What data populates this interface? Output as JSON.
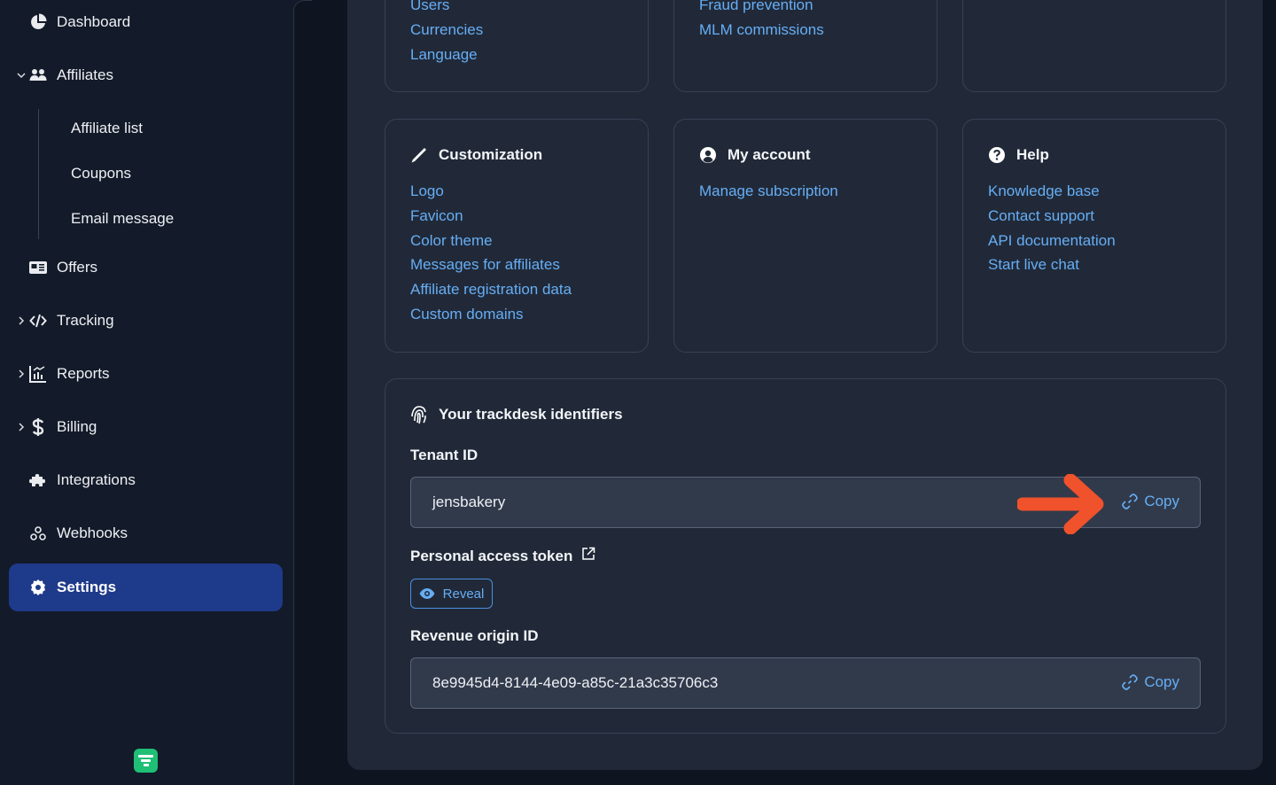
{
  "sidebar": {
    "items": [
      {
        "label": "Dashboard",
        "icon": "pie-chart-icon"
      },
      {
        "label": "Affiliates",
        "icon": "users-icon",
        "expanded": true
      },
      {
        "label": "Offers",
        "icon": "id-card-icon"
      },
      {
        "label": "Tracking",
        "icon": "code-icon",
        "expandable": true
      },
      {
        "label": "Reports",
        "icon": "chart-icon",
        "expandable": true
      },
      {
        "label": "Billing",
        "icon": "dollar-icon",
        "expandable": true
      },
      {
        "label": "Integrations",
        "icon": "puzzle-icon"
      },
      {
        "label": "Webhooks",
        "icon": "webhook-icon"
      },
      {
        "label": "Settings",
        "icon": "gear-icon",
        "active": true
      }
    ],
    "affiliates_sub": [
      "Affiliate list",
      "Coupons",
      "Email message"
    ]
  },
  "cards": {
    "general_partial": {
      "links": [
        "Users",
        "Currencies",
        "Language"
      ]
    },
    "program_partial": {
      "links": [
        "Fraud prevention",
        "MLM commissions"
      ]
    },
    "customization": {
      "title": "Customization",
      "links": [
        "Logo",
        "Favicon",
        "Color theme",
        "Messages for affiliates",
        "Affiliate registration data",
        "Custom domains"
      ]
    },
    "my_account": {
      "title": "My account",
      "links": [
        "Manage subscription"
      ]
    },
    "help": {
      "title": "Help",
      "links": [
        "Knowledge base",
        "Contact support",
        "API documentation",
        "Start live chat"
      ]
    }
  },
  "identifiers": {
    "title": "Your trackdesk identifiers",
    "tenant_label": "Tenant ID",
    "tenant_value": "jensbakery",
    "copy_label": "Copy",
    "token_label": "Personal access token",
    "reveal_label": "Reveal",
    "revenue_label": "Revenue origin ID",
    "revenue_value": "8e9945d4-8144-4e09-a85c-21a3c35706c3"
  },
  "colors": {
    "accent_link": "#66aef5",
    "active_nav": "#1e3a8a",
    "annotation_arrow": "#f0522b",
    "brand": "#1fbf75"
  }
}
